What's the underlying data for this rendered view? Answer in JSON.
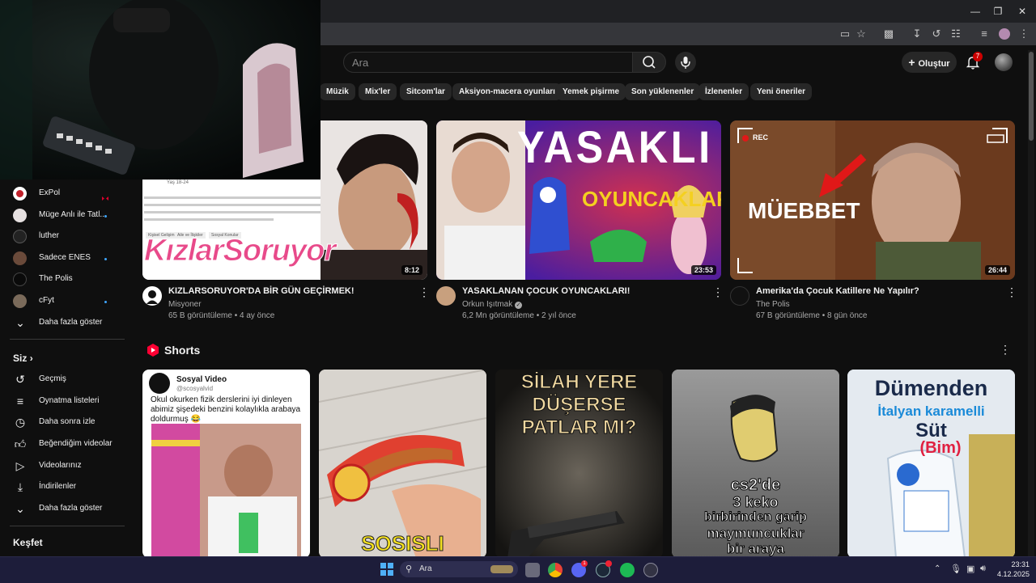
{
  "header": {
    "search_placeholder": "Ara",
    "create_label": "Oluştur",
    "notification_count": "7"
  },
  "chips": [
    "Müzik",
    "Mix'ler",
    "Sitcom'lar",
    "Aksiyon-macera oyunları",
    "Yemek pişirme",
    "Son yüklenenler",
    "İzlenenler",
    "Yeni öneriler"
  ],
  "sidebar": {
    "subscriptions": [
      {
        "label": "ExPol",
        "color": "#c0202a",
        "badge": "live"
      },
      {
        "label": "Müge Anlı ile Tatl...",
        "color": "#d8d8d8",
        "badge": "dot"
      },
      {
        "label": "luther",
        "color": "#222",
        "badge": ""
      },
      {
        "label": "Sadece ENES",
        "color": "#6a4a3a",
        "badge": "dot"
      },
      {
        "label": "The Polis",
        "color": "#111",
        "badge": ""
      },
      {
        "label": "cFyt",
        "color": "#7a6a5a",
        "badge": "dot"
      }
    ],
    "show_more": "Daha fazla göster",
    "you_heading": "Siz",
    "you_items": [
      {
        "label": "Geçmiş",
        "icon": "history-icon"
      },
      {
        "label": "Oynatma listeleri",
        "icon": "playlist-icon"
      },
      {
        "label": "Daha sonra izle",
        "icon": "clock-icon"
      },
      {
        "label": "Beğendiğim videolar",
        "icon": "thumbs-up-icon"
      },
      {
        "label": "Videolarınız",
        "icon": "your-videos-icon"
      },
      {
        "label": "İndirilenler",
        "icon": "download-icon"
      }
    ],
    "show_more_2": "Daha fazla göster",
    "explore_heading": "Keşfet"
  },
  "videos": [
    {
      "title": "KIZLARSORUYOR'DA BİR GÜN GEÇİRMEK!",
      "channel": "Misyoner",
      "verified": false,
      "meta": "65 B görüntüleme • 4 ay önce",
      "duration": "8:12",
      "thumb_text": "KızlarSoruyor",
      "tag1": "Kişisel Gelişim",
      "tag2": "Aile ve İlişkiler",
      "tag3": "Sosyal Konular",
      "post_time": "Yaş 18-24"
    },
    {
      "title": "YASAKLANAN ÇOCUK OYUNCAKLARI!",
      "channel": "Orkun Işıtmak",
      "verified": true,
      "meta": "6,2 Mn görüntüleme • 2 yıl önce",
      "duration": "23:53",
      "thumb_text1": "YASAKLI",
      "thumb_text2": "OYUNCAKLAR"
    },
    {
      "title": "Amerika'da Çocuk Katillere Ne Yapılır?",
      "channel": "The Polis",
      "verified": false,
      "meta": "67 B görüntüleme • 8 gün önce",
      "duration": "26:44",
      "thumb_text": "MÜEBBET",
      "rec": "REC"
    }
  ],
  "shorts": {
    "heading": "Shorts",
    "items": [
      {
        "account": "Sosyal Video",
        "handle": "@scosyalvid",
        "caption": "Okul okurken fizik derslerini iyi dinleyen abimiz şişedeki benzini kolaylıkla arabaya doldurmuş 😂"
      },
      {
        "overlay": "SOSISLI"
      },
      {
        "overlay1": "SİLAH YERE",
        "overlay2": "DÜŞERSE",
        "overlay3": "PATLAR MI?"
      },
      {
        "overlay1": "cs2'de",
        "overlay2": "3 keko",
        "overlay3": "birbirinden garip",
        "overlay4": "maymuncuklar",
        "overlay5": "bir araya"
      },
      {
        "overlay1": "Dümenden",
        "overlay2": "İtalyan karamelli",
        "overlay3": "Süt",
        "overlay4": "(Bim)"
      }
    ]
  },
  "taskbar": {
    "search": "Ara",
    "time": "23:31",
    "date": "4.12.2025",
    "discord_badge": "1"
  },
  "colors": {
    "accent": "#3ea6ff",
    "shorts_red": "#ff0033",
    "taskbar": "#1d1d3a"
  }
}
